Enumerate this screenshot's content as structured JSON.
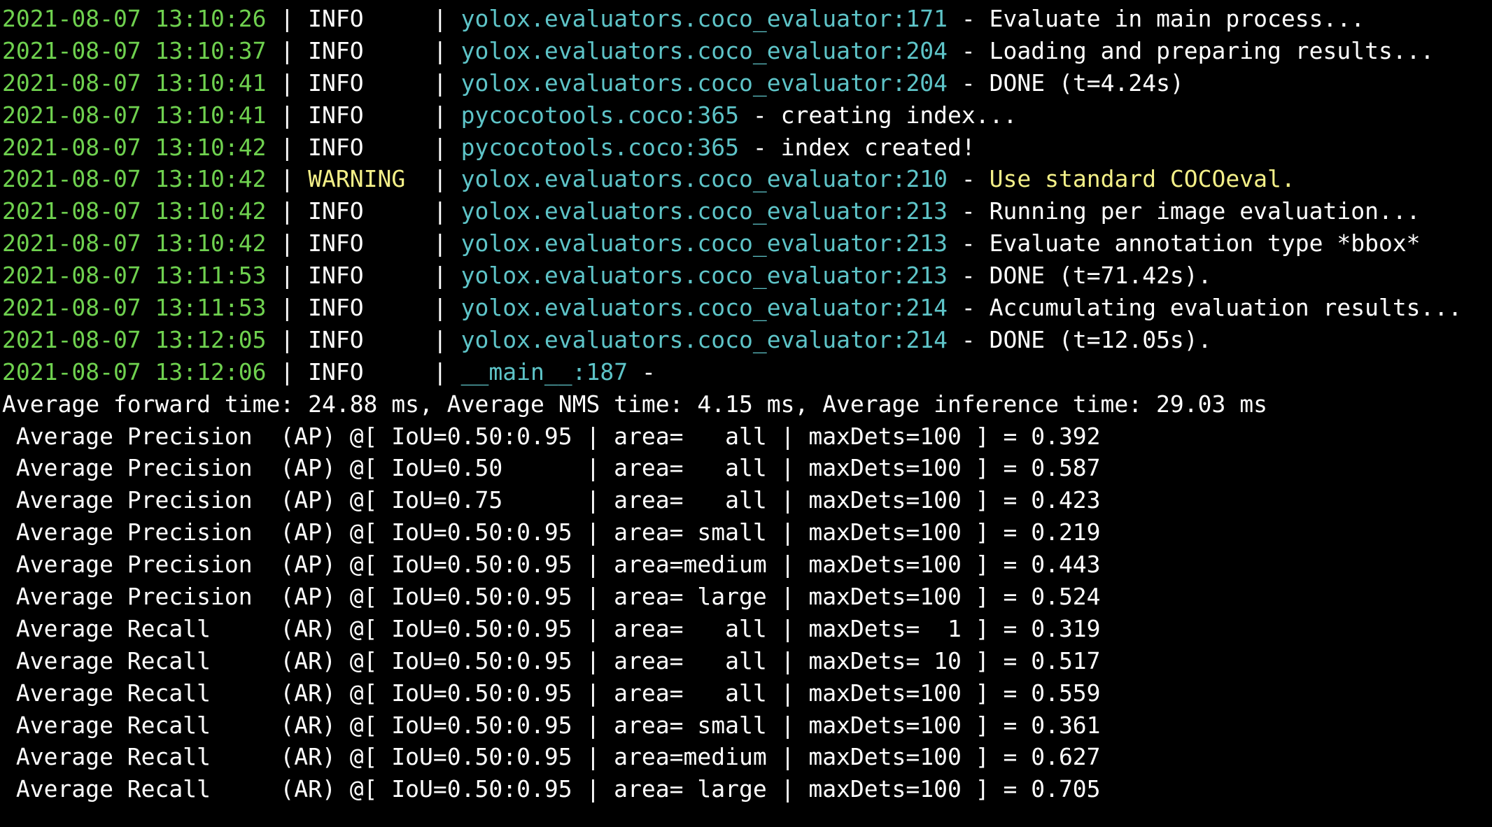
{
  "log_lines": [
    {
      "ts": "2021-08-07 13:10:26",
      "level": "INFO    ",
      "module": "yolox.evaluators.coco_evaluator:171",
      "message": "Evaluate in main process..."
    },
    {
      "ts": "2021-08-07 13:10:37",
      "level": "INFO    ",
      "module": "yolox.evaluators.coco_evaluator:204",
      "message": "Loading and preparing results..."
    },
    {
      "ts": "2021-08-07 13:10:41",
      "level": "INFO    ",
      "module": "yolox.evaluators.coco_evaluator:204",
      "message": "DONE (t=4.24s)"
    },
    {
      "ts": "2021-08-07 13:10:41",
      "level": "INFO    ",
      "module": "pycocotools.coco:365",
      "message": "creating index..."
    },
    {
      "ts": "2021-08-07 13:10:42",
      "level": "INFO    ",
      "module": "pycocotools.coco:365",
      "message": "index created!"
    },
    {
      "ts": "2021-08-07 13:10:42",
      "level": "WARNING ",
      "module": "yolox.evaluators.coco_evaluator:210",
      "message": "Use standard COCOeval."
    },
    {
      "ts": "2021-08-07 13:10:42",
      "level": "INFO    ",
      "module": "yolox.evaluators.coco_evaluator:213",
      "message": "Running per image evaluation..."
    },
    {
      "ts": "2021-08-07 13:10:42",
      "level": "INFO    ",
      "module": "yolox.evaluators.coco_evaluator:213",
      "message": "Evaluate annotation type *bbox*"
    },
    {
      "ts": "2021-08-07 13:11:53",
      "level": "INFO    ",
      "module": "yolox.evaluators.coco_evaluator:213",
      "message": "DONE (t=71.42s)."
    },
    {
      "ts": "2021-08-07 13:11:53",
      "level": "INFO    ",
      "module": "yolox.evaluators.coco_evaluator:214",
      "message": "Accumulating evaluation results..."
    },
    {
      "ts": "2021-08-07 13:12:05",
      "level": "INFO    ",
      "module": "yolox.evaluators.coco_evaluator:214",
      "message": "DONE (t=12.05s)."
    },
    {
      "ts": "2021-08-07 13:12:06",
      "level": "INFO    ",
      "module": "__main__:187",
      "message": ""
    }
  ],
  "timing_line": "Average forward time: 24.88 ms, Average NMS time: 4.15 ms, Average inference time: 29.03 ms",
  "metric_lines": [
    " Average Precision  (AP) @[ IoU=0.50:0.95 | area=   all | maxDets=100 ] = 0.392",
    " Average Precision  (AP) @[ IoU=0.50      | area=   all | maxDets=100 ] = 0.587",
    " Average Precision  (AP) @[ IoU=0.75      | area=   all | maxDets=100 ] = 0.423",
    " Average Precision  (AP) @[ IoU=0.50:0.95 | area= small | maxDets=100 ] = 0.219",
    " Average Precision  (AP) @[ IoU=0.50:0.95 | area=medium | maxDets=100 ] = 0.443",
    " Average Precision  (AP) @[ IoU=0.50:0.95 | area= large | maxDets=100 ] = 0.524",
    " Average Recall     (AR) @[ IoU=0.50:0.95 | area=   all | maxDets=  1 ] = 0.319",
    " Average Recall     (AR) @[ IoU=0.50:0.95 | area=   all | maxDets= 10 ] = 0.517",
    " Average Recall     (AR) @[ IoU=0.50:0.95 | area=   all | maxDets=100 ] = 0.559",
    " Average Recall     (AR) @[ IoU=0.50:0.95 | area= small | maxDets=100 ] = 0.361",
    " Average Recall     (AR) @[ IoU=0.50:0.95 | area=medium | maxDets=100 ] = 0.627",
    " Average Recall     (AR) @[ IoU=0.50:0.95 | area= large | maxDets=100 ] = 0.705"
  ],
  "separator": " | ",
  "dash": " - ",
  "colors": {
    "background": "#000000",
    "timestamp": "#6fd14f",
    "module": "#5ec4c8",
    "warning": "#f4f088",
    "text": "#ffffff"
  }
}
